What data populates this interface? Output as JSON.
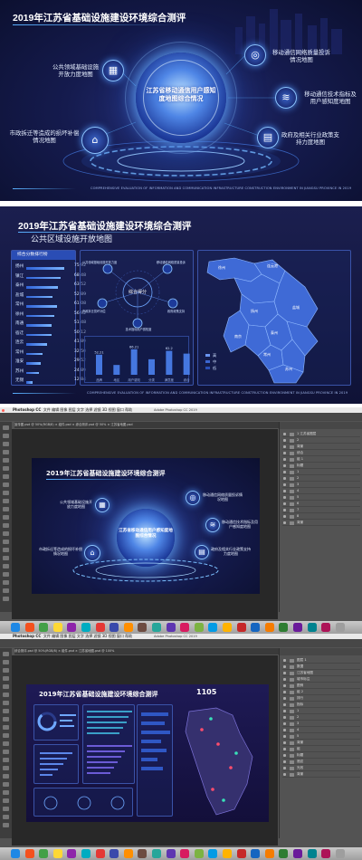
{
  "panel1": {
    "title": "2019年江苏省基础设施建设环境综合测评",
    "center": "江苏省移动通信用户感知度地图综合情况",
    "features": [
      {
        "label": "公共领域基础设施开放力度地图",
        "icon": "building-icon"
      },
      {
        "label": "市政拆迁等造成的损坏补偿情况地图",
        "icon": "house-icon"
      },
      {
        "label": "移动通信网络质量投诉情况地图",
        "icon": "globe-icon"
      },
      {
        "label": "移动通信技术指标及用户感知度地图",
        "icon": "wifi-icon"
      },
      {
        "label": "政府及相关行业政策支持力度地图",
        "icon": "document-icon"
      }
    ],
    "footer": "COMPREHENSIVE EVALUATION OF INFORMATION AND COMMUNICATION INFRASTRUCTURE CONSTRUCTION ENVIRONMENT IN JIANGSU PROVINCE IN 2019"
  },
  "panel2": {
    "title": "2019年江苏省基础设施建设环境综合测评",
    "subtitle": "公共区域设施开放地图",
    "ranking_title": "综合分数排行榜",
    "ranking": [
      {
        "name": "扬州",
        "value": "75.92"
      },
      {
        "name": "镇江",
        "value": "68.48"
      },
      {
        "name": "泰州",
        "value": "63.52"
      },
      {
        "name": "盐城",
        "value": "52.89"
      },
      {
        "name": "常州",
        "value": "61.08"
      },
      {
        "name": "徐州",
        "value": "56.92"
      },
      {
        "name": "南通",
        "value": "51.48"
      },
      {
        "name": "宿迁",
        "value": "50.12"
      },
      {
        "name": "连云",
        "value": "41.89"
      },
      {
        "name": "常州",
        "value": "32.50"
      },
      {
        "name": "淮安",
        "value": "29.52"
      },
      {
        "name": "苏州",
        "value": "24.89"
      },
      {
        "name": "无锡",
        "value": "12.84"
      }
    ],
    "score_label": "综合得分",
    "nodes": [
      "公共领域基础设施开放力度",
      "移动通信网络质量投诉",
      "市政拆迁损坏补偿",
      "政府政策支持",
      "技术指标用户感知度"
    ],
    "chart_data": {
      "type": "bar",
      "categories": [
        "指标1",
        "指标2",
        "指标3",
        "指标4",
        "指标5",
        "指标6"
      ],
      "values": [
        52.21,
        25.5,
        66.21,
        40.3,
        62.2,
        55.0
      ],
      "value_labels": [
        "52.21",
        "",
        "66.21",
        "",
        "62.2",
        ""
      ],
      "xlabels": [
        "品牌",
        "地区",
        "用户感知",
        "分类",
        "满意度",
        "综合"
      ]
    },
    "cities": [
      "徐州",
      "连云港",
      "宿迁",
      "淮安",
      "盐城",
      "扬州",
      "泰州",
      "南通",
      "南京",
      "镇江",
      "常州",
      "无锡",
      "苏州"
    ],
    "legend": [
      "高",
      "中",
      "低"
    ],
    "footer": "COMPREHENSIVE EVALUATION OF INFORMATION AND COMMUNICATION INFRASTRUCTURE CONSTRUCTION ENVIRONMENT IN JIANGSU PROVINCE IN 2019"
  },
  "ps1": {
    "app": "Photoshop CC",
    "menus": "文件 编辑 图像 图层 文字 选择 滤镜 3D 视图 窗口 帮助",
    "window_title": "Adobe Photoshop CC 2019",
    "tabs": "宣传图.psd @ 50%(RGB/8) × 组件.psd × 综合测评.psd @ 50% × 江苏省地图.psd",
    "layers": [
      "1 江苏省图层",
      "2",
      "背景",
      "综合",
      "组 1",
      "标题",
      "1",
      "2",
      "3",
      "4",
      "5",
      "6",
      "7",
      "8",
      "背景"
    ]
  },
  "ps2": {
    "app": "Photoshop CC",
    "menus": "文件 编辑 图像 图层 文字 选择 滤镜 3D 视图 窗口 帮助",
    "window_title": "Adobe Photoshop CC 2019",
    "tabs": "综合测评.psd @ 50%(RGB/8) × 组件.psd × 江苏省地图.psd @ 100%",
    "title": "2019年江苏省基础设施建设环境综合测评",
    "counter": "1105",
    "layers": [
      "图层 1",
      "数据",
      "江苏省地图",
      "城市标注",
      "图例",
      "组 2",
      "排行",
      "指标",
      "1",
      "2",
      "3",
      "4",
      "5",
      "背景",
      "组",
      "标题",
      "底纹",
      "光效",
      "背景"
    ]
  },
  "colors": {
    "accent": "#5ab0ff",
    "dark": "#0c1030",
    "ps_gray": "#535353"
  }
}
